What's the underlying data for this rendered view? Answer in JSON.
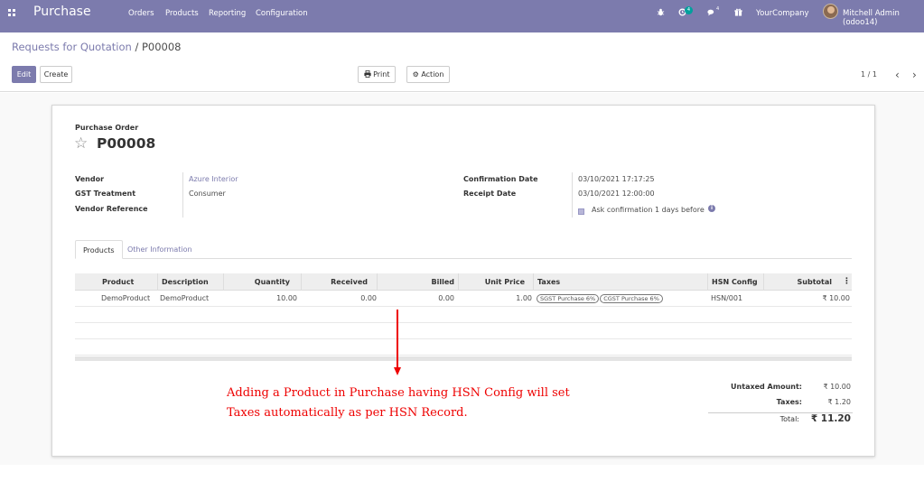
{
  "navbar": {
    "brand": "Purchase",
    "menu": [
      "Orders",
      "Products",
      "Reporting",
      "Configuration"
    ],
    "activity_badge": "4",
    "chat_badge": "4",
    "company": "YourCompany",
    "user": "Mitchell Admin (odoo14)"
  },
  "breadcrumb": {
    "parent": "Requests for Quotation",
    "separator": "/",
    "current": "P00008"
  },
  "toolbar": {
    "edit_label": "Edit",
    "create_label": "Create",
    "print_label": "Print",
    "action_label": "Action",
    "pager": "1 / 1"
  },
  "form": {
    "doc_type": "Purchase Order",
    "name": "P00008",
    "vendor_label": "Vendor",
    "vendor": "Azure Interior",
    "gst_label": "GST Treatment",
    "gst": "Consumer",
    "vendor_ref_label": "Vendor Reference",
    "vendor_ref": "",
    "confirmation_date_label": "Confirmation Date",
    "confirmation_date": "03/10/2021 17:17:25",
    "receipt_date_label": "Receipt Date",
    "receipt_date": "03/10/2021 12:00:00",
    "ask_confirmation_prefix": "Ask confirmation",
    "ask_confirmation_days": "1",
    "ask_confirmation_suffix": "days before"
  },
  "tabs": [
    "Products",
    "Other Information"
  ],
  "table": {
    "headers": [
      "Product",
      "Description",
      "Quantity",
      "Received",
      "Billed",
      "Unit Price",
      "Taxes",
      "HSN Config",
      "Subtotal"
    ],
    "rows": [
      {
        "product": "DemoProduct",
        "description": "DemoProduct",
        "quantity": "10.00",
        "received": "0.00",
        "billed": "0.00",
        "unit_price": "1.00",
        "taxes": [
          "SGST Purchase 6%",
          "CGST Purchase 6%"
        ],
        "hsn": "HSN/001",
        "subtotal": "₹ 10.00"
      }
    ]
  },
  "annotation": {
    "line1": "Adding a Product in Purchase having HSN Config will set",
    "line2": "Taxes automatically as per HSN Record."
  },
  "totals": {
    "untaxed_label": "Untaxed Amount:",
    "untaxed": "₹ 10.00",
    "taxes_label": "Taxes:",
    "taxes": "₹ 1.20",
    "total_label": "Total:",
    "total": "₹ 11.20"
  },
  "colors": {
    "brand": "#7c7bad",
    "annotation": "#e00000"
  }
}
